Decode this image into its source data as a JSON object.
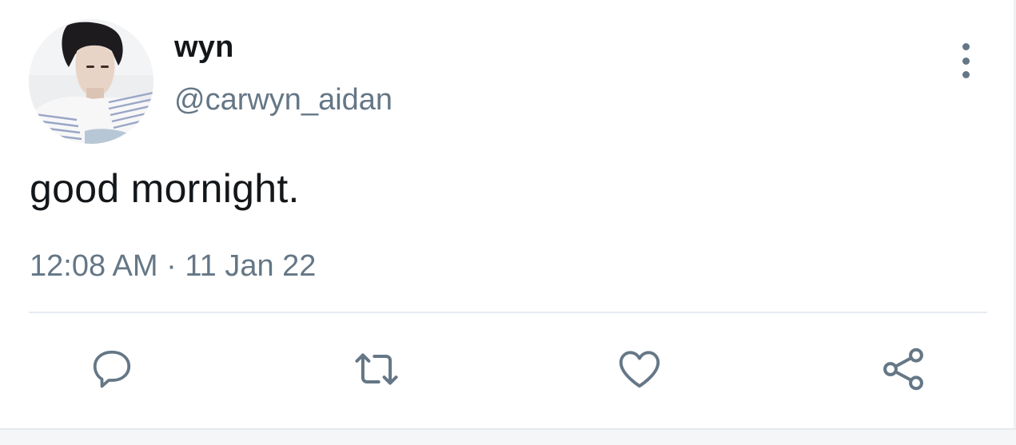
{
  "tweet": {
    "display_name": "wyn",
    "handle": "@carwyn_aidan",
    "text": "good mornight.",
    "time": "12:08 AM",
    "separator": "·",
    "date": "11 Jan 22"
  },
  "icons": {
    "avatar": "avatar-photo",
    "more": "more-vertical-icon",
    "reply": "reply-icon",
    "retweet": "retweet-icon",
    "like": "heart-icon",
    "share": "share-icon"
  },
  "colors": {
    "text_primary": "#14171a",
    "text_secondary": "#657786",
    "divider": "#e6ecf0",
    "background": "#ffffff"
  }
}
